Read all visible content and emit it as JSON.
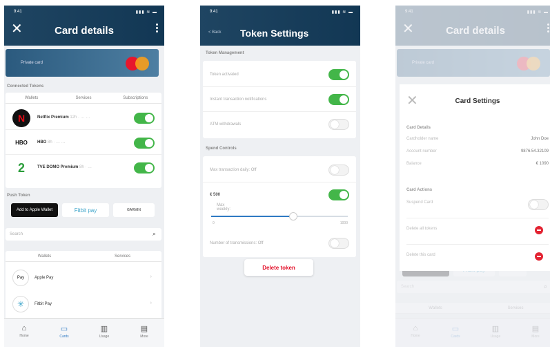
{
  "s1": {
    "time": "9:41",
    "signal": "▮▮▮ ≋ ▬",
    "title": "Card details",
    "card": "Private card",
    "sec_connected": "Connected Tokens",
    "tabs": [
      "Wallets",
      "Services",
      "Subscriptions"
    ],
    "tokens": [
      {
        "name": "Netflix Premium",
        "sub": "12h · … …",
        "icon": "N"
      },
      {
        "name": "HBO",
        "sub": "8h · … …",
        "icon": "HBO"
      },
      {
        "name": "TVE DOMO Premium",
        "sub": "8h · …",
        "icon": "2"
      }
    ],
    "sec_push": "Push Token",
    "push": [
      {
        "label": "Add to Apple Wallet"
      },
      {
        "label": "Fitbit pay"
      },
      {
        "label": "GARMIN"
      }
    ],
    "search": "Search",
    "tabs2": [
      "Wallets",
      "Services"
    ],
    "list": [
      {
        "name": "Apple Pay",
        "icon": "Pay"
      },
      {
        "name": "Fitbit Pay",
        "icon": "✳"
      }
    ],
    "nav": [
      {
        "icon": "⌂",
        "label": "Home"
      },
      {
        "icon": "▭",
        "label": "Cards"
      },
      {
        "icon": "▥",
        "label": "Usage"
      },
      {
        "icon": "▤",
        "label": "More"
      }
    ]
  },
  "s2": {
    "time": "9:41",
    "back": "< Back",
    "title": "Token Settings",
    "sec_mgmt": "Token Management",
    "mgmt": [
      {
        "label": "Token activated",
        "on": true
      },
      {
        "label": "Instant transaction notifications",
        "on": true
      },
      {
        "label": "ATM withdrawals",
        "on": false
      }
    ],
    "sec_spend": "Spend Controls",
    "spend": [
      {
        "label": "Max transaction daily: Off",
        "on": false
      },
      {
        "label": "Max weekly:",
        "amount": "€ 500",
        "on": true
      },
      {
        "label": "Number of transmissions: Off",
        "on": false
      }
    ],
    "slider": {
      "min": "0",
      "max": "1000",
      "value": 0.6
    },
    "delete": "Delete token"
  },
  "s3": {
    "time": "9:41",
    "title": "Card details",
    "card": "Private card",
    "sheet_title": "Card Settings",
    "sec_details": "Card Details",
    "details": [
      {
        "k": "Cardholder name",
        "v": "John Doe"
      },
      {
        "k": "Account number",
        "v": "9876.54.32109"
      },
      {
        "k": "Balance",
        "v": "€ 1090"
      }
    ],
    "sec_actions": "Card Actions",
    "actions": [
      {
        "label": "Suspend Card"
      },
      {
        "label": "Delete all tokens"
      },
      {
        "label": "Delete this card"
      }
    ],
    "search": "Search",
    "tabs": [
      "Wallets",
      "Services"
    ],
    "nav": [
      {
        "icon": "⌂",
        "label": "Home"
      },
      {
        "icon": "▭",
        "label": "Cards"
      },
      {
        "icon": "▥",
        "label": "Usage"
      },
      {
        "icon": "▤",
        "label": "More"
      }
    ]
  }
}
